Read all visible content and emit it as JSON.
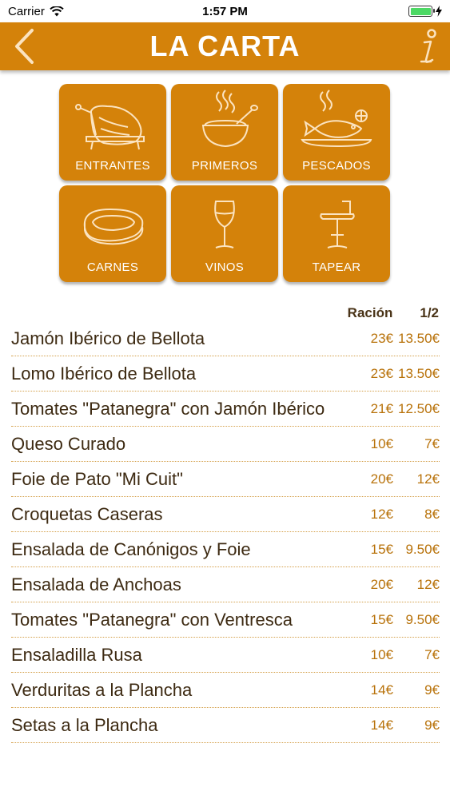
{
  "status_bar": {
    "carrier": "Carrier",
    "time": "1:57 PM",
    "battery_level": 1.0
  },
  "nav": {
    "title": "LA CARTA"
  },
  "categories": [
    {
      "label": "ENTRANTES",
      "icon": "ham-leg-icon"
    },
    {
      "label": "PRIMEROS",
      "icon": "soup-bowl-icon"
    },
    {
      "label": "PESCADOS",
      "icon": "fish-plate-icon"
    },
    {
      "label": "CARNES",
      "icon": "steak-icon"
    },
    {
      "label": "VINOS",
      "icon": "wine-glass-icon"
    },
    {
      "label": "TAPEAR",
      "icon": "bar-stool-icon"
    }
  ],
  "list_header": {
    "col1": "Ración",
    "col2": "1/2"
  },
  "items": [
    {
      "name": "Jamón Ibérico de Bellota",
      "racion": "23€",
      "half": "13.50€"
    },
    {
      "name": "Lomo Ibérico de Bellota",
      "racion": "23€",
      "half": "13.50€"
    },
    {
      "name": "Tomates \"Patanegra\" con Jamón Ibérico",
      "racion": "21€",
      "half": "12.50€"
    },
    {
      "name": "Queso Curado",
      "racion": "10€",
      "half": "7€"
    },
    {
      "name": "Foie de Pato \"Mi Cuit\"",
      "racion": "20€",
      "half": "12€"
    },
    {
      "name": "Croquetas Caseras",
      "racion": "12€",
      "half": "8€"
    },
    {
      "name": "Ensalada de Canónigos y Foie",
      "racion": "15€",
      "half": "9.50€"
    },
    {
      "name": "Ensalada de Anchoas",
      "racion": "20€",
      "half": "12€"
    },
    {
      "name": "Tomates \"Patanegra\" con Ventresca",
      "racion": "15€",
      "half": "9.50€"
    },
    {
      "name": "Ensaladilla Rusa",
      "racion": "10€",
      "half": "7€"
    },
    {
      "name": "Verduritas a la Plancha",
      "racion": "14€",
      "half": "9€"
    },
    {
      "name": "Setas a la Plancha",
      "racion": "14€",
      "half": "9€"
    }
  ],
  "colors": {
    "accent": "#d4820a",
    "text": "#3d2a12",
    "price": "#b8720a"
  }
}
